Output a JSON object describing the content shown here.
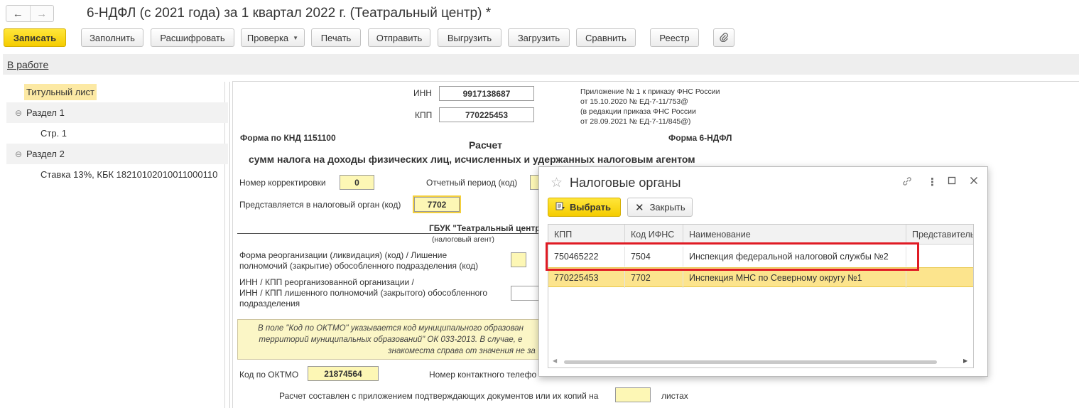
{
  "window": {
    "title": "6-НДФЛ (с 2021 года) за 1 квартал 2022 г. (Театральный центр) *",
    "back_glyph": "←",
    "forward_glyph": "→"
  },
  "toolbar": {
    "save": "Записать",
    "fill": "Заполнить",
    "decode": "Расшифровать",
    "check": "Проверка",
    "print": "Печать",
    "send": "Отправить",
    "export": "Выгрузить",
    "import": "Загрузить",
    "compare": "Сравнить",
    "registry": "Реестр",
    "attach_icon": "paperclip-icon"
  },
  "status": {
    "link": "В работе"
  },
  "tree": [
    {
      "label": "Титульный лист",
      "selected": true
    },
    {
      "label": "Раздел 1",
      "toggle": "⊖"
    },
    {
      "label": "Стр. 1"
    },
    {
      "label": "Раздел 2",
      "toggle": "⊖"
    },
    {
      "label": "Ставка 13%, КБК 18210102010011000110"
    }
  ],
  "form": {
    "inn_label": "ИНН",
    "inn": "9917138687",
    "kpp_label": "КПП",
    "kpp": "770225453",
    "appendix": [
      "Приложение № 1 к приказу ФНС России",
      "от 15.10.2020 № ЕД-7-11/753@",
      "(в редакции приказа ФНС России",
      "от 28.09.2021 № ЕД-7-11/845@)"
    ],
    "knd": "Форма по КНД 1151100",
    "form_name": "Форма 6-НДФЛ",
    "heading": "Расчет",
    "subheading": "сумм налога на доходы физических лиц, исчисленных и удержанных налоговым агентом",
    "correction_label": "Номер корректировки",
    "correction": "0",
    "period_label": "Отчетный период (код)",
    "tax_office_label": "Представляется в налоговый орган (код)",
    "tax_office": "7702",
    "agent_name": "ГБУК \"Театральный центр",
    "agent_caption": "(налоговый агент)",
    "reorg_label_1": "Форма реорганизации (ликвидация) (код) / Лишение",
    "reorg_label_2": "полномочий (закрытие) обособленного подразделения (код)",
    "reorg_inn_1": "ИНН / КПП реорганизованной организации /",
    "reorg_inn_2": "ИНН / КПП лишенного полномочий (закрытого) обособленного",
    "reorg_inn_3": "подразделения",
    "note_1": "В поле \"Код по ОКТМО\" указывается код муниципального образован",
    "note_2": "территорий муниципальных образований\" ОК 033-2013. В случае, е",
    "note_3": "знакоместа справа от значения не за",
    "oktmo_label": "Код по ОКТМО",
    "oktmo": "21874564",
    "phone_label": "Номер контактного телефо",
    "attached_label": "Расчет составлен с приложением подтверждающих документов или их копий на",
    "sheets_label": "листах"
  },
  "dialog": {
    "title": "Налоговые органы",
    "star_icon": "star-icon",
    "select": "Выбрать",
    "close": "Закрыть",
    "columns": [
      "КПП",
      "Код ИФНС",
      "Наименование",
      "Представитель"
    ],
    "rows": [
      {
        "kpp": "750465222",
        "code": "7504",
        "name": "Инспекция федеральной налоговой службы №2",
        "rep": "",
        "highlighted": true
      },
      {
        "kpp": "770225453",
        "code": "7702",
        "name": "Инспекция МНС по Северному округу №1",
        "rep": "",
        "selected": true
      }
    ],
    "highlight_color": "#e01b24"
  }
}
